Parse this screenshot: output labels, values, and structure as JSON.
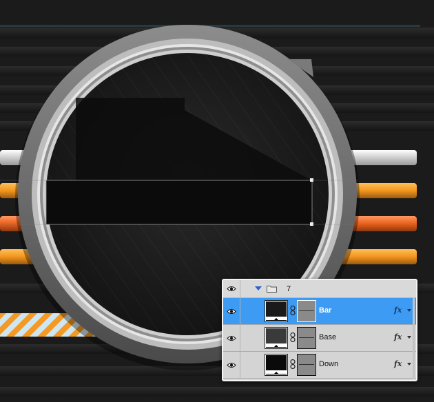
{
  "canvas": {
    "background": "#1c1c1c",
    "accent_colors": [
      "#f29a23",
      "#e8641f",
      "#ffffff",
      "#2f2f2f"
    ]
  },
  "layers_panel": {
    "group": {
      "name": "7",
      "icon": "folder-icon",
      "expanded": true
    },
    "layers": [
      {
        "name": "Bar",
        "selected": true,
        "thumb_color": "#1a1a1a",
        "has_fx": true
      },
      {
        "name": "Base",
        "selected": false,
        "thumb_color": "#3a3a3a",
        "has_fx": true
      },
      {
        "name": "Down",
        "selected": false,
        "thumb_color": "#0a0a0a",
        "has_fx": true
      }
    ],
    "fx_label": "fx",
    "selection_color": "#3d9bf4"
  }
}
